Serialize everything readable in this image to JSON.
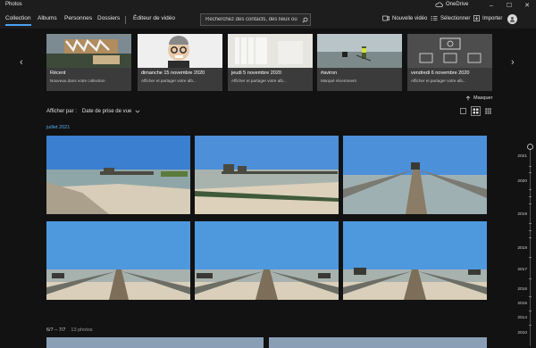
{
  "app": {
    "title": "Photos",
    "onedrive_label": "OneDrive",
    "window_controls": [
      "minimize-icon",
      "maximize-icon",
      "close-icon"
    ]
  },
  "nav": {
    "tabs": [
      {
        "label": "Collection",
        "active": true
      },
      {
        "label": "Albums",
        "active": false
      },
      {
        "label": "Personnes",
        "active": false
      },
      {
        "label": "Dossiers",
        "active": false
      },
      {
        "label": "Éditeur de vidéo",
        "active": false
      }
    ],
    "search_placeholder": "Recherchez des contacts, des lieux ou",
    "actions": [
      {
        "label": "Nouvelle vidéo",
        "icon": "video-icon"
      },
      {
        "label": "Sélectionner",
        "icon": "select-icon"
      },
      {
        "label": "Importer",
        "icon": "import-icon"
      }
    ]
  },
  "highlights": [
    {
      "title": "Récent",
      "subtitle": "Nouveau dans votre collection"
    },
    {
      "title": "dimanche 15 novembre 2020",
      "subtitle": "Afficher et partager votre alb..."
    },
    {
      "title": "jeudi 5 novembre 2020",
      "subtitle": "Afficher et partager votre alb..."
    },
    {
      "title": "#aviron",
      "subtitle": "Marqué récemment"
    },
    {
      "title": "vendredi 6 novembre 2020",
      "subtitle": "Afficher et partager votre alb..."
    }
  ],
  "hide_label": "Masquer",
  "sort": {
    "label": "Afficher par :",
    "value": "Date de prise de vue"
  },
  "view_modes": [
    "single-view-icon",
    "medium-grid-icon",
    "small-grid-icon"
  ],
  "groups": [
    {
      "label": "juillet 2021",
      "count": ""
    },
    {
      "label": "6/7 – 7/7",
      "count": "13 photos"
    }
  ],
  "timeline": {
    "years": [
      "2021",
      "2020",
      "2019",
      "2018",
      "2017",
      "2016",
      "2015",
      "2014",
      "2010"
    ]
  },
  "colors": {
    "accent": "#4aa3f0",
    "background": "#121212",
    "bar": "#1d1d1d"
  }
}
